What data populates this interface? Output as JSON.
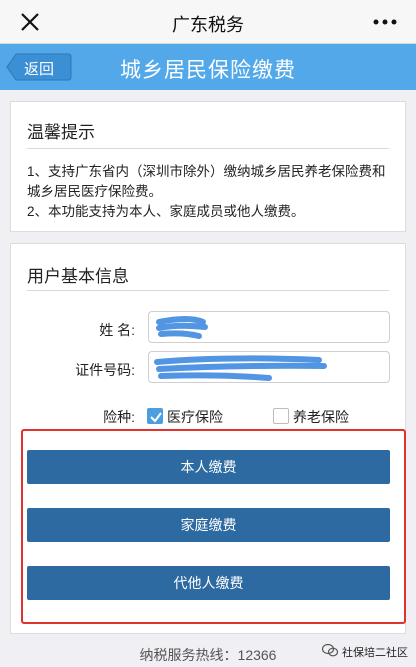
{
  "wechat_bar": {
    "title": "广东税务"
  },
  "header": {
    "back_label": "返回",
    "title": "城乡居民保险缴费"
  },
  "tips": {
    "heading": "温馨提示",
    "line1": "1、支持广东省内（深圳市除外）缴纳城乡居民养老保险费和城乡居民医疗保险费。",
    "line2": "2、本功能支持为本人、家庭成员或他人缴费。"
  },
  "user_info": {
    "heading": "用户基本信息",
    "name_label": "姓 名:",
    "id_label": "证件号码:",
    "insurance_label": "险种:",
    "options": [
      {
        "label": "医疗保险",
        "checked": true
      },
      {
        "label": "养老保险",
        "checked": false
      }
    ]
  },
  "buttons": {
    "self": "本人缴费",
    "family": "家庭缴费",
    "others": "代他人缴费"
  },
  "footer": {
    "hotline": "纳税服务热线：12366",
    "watermark": "社保培二社区"
  },
  "colors": {
    "header": "#52a8e8",
    "button": "#2c6aa1",
    "frame": "#e0332d"
  }
}
